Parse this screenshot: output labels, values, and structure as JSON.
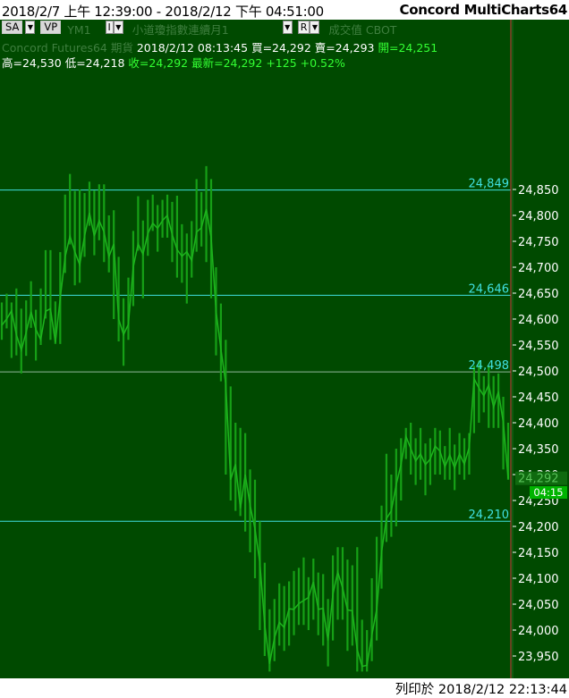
{
  "header": {
    "range_text": "2018/2/7 上午 12:39:00 - 2018/2/12 下午 04:51:00",
    "app_title": "Concord MultiCharts64"
  },
  "toolbar": {
    "sa_button": "SA",
    "vp_button": "VP",
    "symbol": "YM1",
    "i_button": "I",
    "symbol_name": "小道瓊指數連續月1",
    "r_button": "R",
    "volume_label": "成交值",
    "exchange": "CBOT"
  },
  "quote": {
    "source": "Concord Futures64",
    "category": "期貨",
    "datetime": "2018/2/12  08:13:45",
    "bid": "買=24,292",
    "ask": "賣=24,293",
    "open": "開=24,251",
    "high": "高=24,530",
    "low": "低=24,218",
    "close": "收=24,292",
    "last": "最新=24,292",
    "change": "+125",
    "change_pct": "+0.52%"
  },
  "price_marker": {
    "price": "24,292",
    "time": "04:15"
  },
  "footer": {
    "print_text": "列印於 2018/2/12 22:13:44"
  },
  "colors": {
    "background": "#004a00",
    "bars": "#16a016",
    "levels": "#40e0e0",
    "axis_text": "#ffffff"
  },
  "chart_data": {
    "type": "line",
    "title": "",
    "xlabel": "",
    "ylabel": "",
    "x_range": [
      "2018/2/7 00:39",
      "2018/2/12 16:51"
    ],
    "ylim": [
      23920,
      24998
    ],
    "grid": false,
    "y_ticks": [
      "24,850",
      "24,800",
      "24,750",
      "24,700",
      "24,650",
      "24,600",
      "24,550",
      "24,500",
      "24,450",
      "24,400",
      "24,350",
      "24,300",
      "24,250",
      "24,200",
      "24,150",
      "24,100",
      "24,050",
      "24,000",
      "23,950"
    ],
    "horizontal_levels": [
      {
        "value": 24849,
        "label": "24,849"
      },
      {
        "value": 24646,
        "label": "24,646"
      },
      {
        "value": 24498,
        "label": "24,498"
      },
      {
        "value": 24210,
        "label": "24,210"
      }
    ],
    "series": [
      {
        "close": [
          24588,
          24600,
          24616,
          24570,
          24540,
          24574,
          24614,
          24580,
          24560,
          24615,
          24620,
          24555,
          24640,
          24720,
          24760,
          24730,
          24705,
          24760,
          24805,
          24760,
          24790,
          24768,
          24720,
          24745,
          24600,
          24570,
          24590,
          24700,
          24745,
          24725,
          24765,
          24785,
          24775,
          24790,
          24800,
          24763,
          24734,
          24721,
          24730,
          24713,
          24768,
          24776,
          24812,
          24757,
          24615,
          24542,
          24476,
          24290,
          24320,
          24235,
          24300,
          24240,
          24195,
          24131,
          24010,
          23935,
          23985,
          24015,
          24005,
          24041,
          24040,
          24051,
          24057,
          24063,
          24093,
          24040,
          24042,
          23980,
          24069,
          24112,
          24081,
          24039,
          24037,
          23962,
          23930,
          23932,
          23990,
          24040,
          24150,
          24215,
          24230,
          24280,
          24320,
          24374,
          24350,
          24326,
          24340,
          24319,
          24330,
          24355,
          24345,
          24315,
          24338,
          24313,
          24340,
          24320,
          24353,
          24485,
          24467,
          24452,
          24473,
          24430,
          24460,
          24400,
          24292
        ],
        "high": [
          24632,
          24649,
          24632,
          24659,
          24620,
          24636,
          24673,
          24618,
          24659,
          24733,
          24733,
          24634,
          24729,
          24840,
          24880,
          24847,
          24850,
          24843,
          24865,
          24848,
          24860,
          24860,
          24800,
          24810,
          24720,
          24640,
          24680,
          24770,
          24837,
          24790,
          24830,
          24840,
          24820,
          24830,
          24840,
          24826,
          24838,
          24783,
          24765,
          24789,
          24870,
          24845,
          24895,
          24870,
          24700,
          24630,
          24560,
          24470,
          24400,
          24390,
          24380,
          24310,
          24290,
          24210,
          24130,
          24040,
          24060,
          24090,
          24085,
          24094,
          24114,
          24120,
          24140,
          24102,
          24138,
          24111,
          24108,
          24060,
          24144,
          24160,
          24160,
          24136,
          24125,
          24160,
          24020,
          24000,
          24100,
          24180,
          24240,
          24340,
          24300,
          24350,
          24370,
          24390,
          24400,
          24370,
          24390,
          24360,
          24370,
          24390,
          24385,
          24355,
          24390,
          24358,
          24380,
          24370,
          24380,
          24510,
          24520,
          24490,
          24510,
          24490,
          24495,
          24450,
          24400
        ],
        "low": [
          24560,
          24582,
          24525,
          24530,
          24495,
          24529,
          24583,
          24520,
          24550,
          24601,
          24560,
          24552,
          24552,
          24689,
          24744,
          24665,
          24670,
          24720,
          24780,
          24723,
          24752,
          24710,
          24690,
          24600,
          24557,
          24510,
          24560,
          24625,
          24732,
          24640,
          24722,
          24770,
          24730,
          24757,
          24757,
          24710,
          24680,
          24670,
          24630,
          24680,
          24730,
          24740,
          24710,
          24640,
          24530,
          24480,
          24300,
          24250,
          24230,
          24220,
          24190,
          24150,
          24100,
          24000,
          23950,
          23920,
          23940,
          23970,
          23960,
          23970,
          23990,
          24010,
          24010,
          24000,
          24020,
          23990,
          23970,
          23930,
          23980,
          24020,
          24020,
          23960,
          23970,
          23920,
          23920,
          23920,
          23940,
          23980,
          24080,
          24170,
          24180,
          24200,
          24250,
          24330,
          24300,
          24280,
          24290,
          24260,
          24280,
          24300,
          24300,
          24290,
          24290,
          24270,
          24300,
          24290,
          24300,
          24380,
          24400,
          24420,
          24390,
          24390,
          24390,
          24310,
          24290
        ]
      }
    ]
  }
}
